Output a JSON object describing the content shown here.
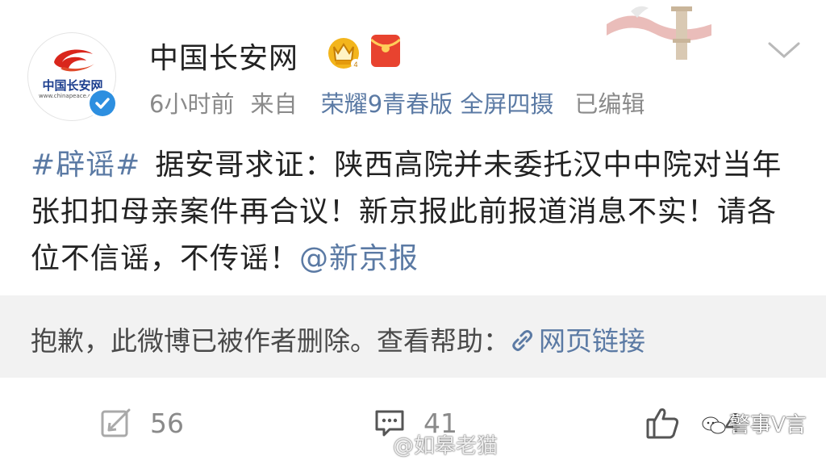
{
  "post": {
    "author": {
      "name": "中国长安网",
      "avatar_text": "中国长安网",
      "avatar_url_text": "www.chinapeace.gov.cn"
    },
    "meta": {
      "time": "6小时前",
      "from_label": "来自",
      "device": "荣耀9青春版 全屏四摄",
      "edited": "已编辑"
    },
    "content": {
      "topic": "#辟谣#",
      "text": "据安哥求证：陕西高院并未委托汉中中院对当年张扣扣母亲案件再合议！新京报此前报道消息不实！请各位不信谣，不传谣！",
      "mention": "@新京报"
    },
    "deleted_notice": {
      "text": "抱歉，此微博已被作者删除。查看帮助：",
      "link": "网页链接"
    },
    "actions": {
      "repost_count": "56",
      "comment_count": "41",
      "like_count": "4"
    }
  },
  "watermarks": {
    "weibo": "@如皋老猫",
    "wechat": "警事V言"
  },
  "icons": [
    "verified-icon",
    "crown-icon",
    "red-packet-icon",
    "chevron-down-icon",
    "link-icon",
    "repost-icon",
    "comment-icon",
    "like-icon"
  ],
  "colors": {
    "link_blue": "#5b7aa4",
    "verified_blue": "#2d8fe0",
    "red_packet": "#e8432f",
    "deleted_bg": "#f2f2f2"
  }
}
